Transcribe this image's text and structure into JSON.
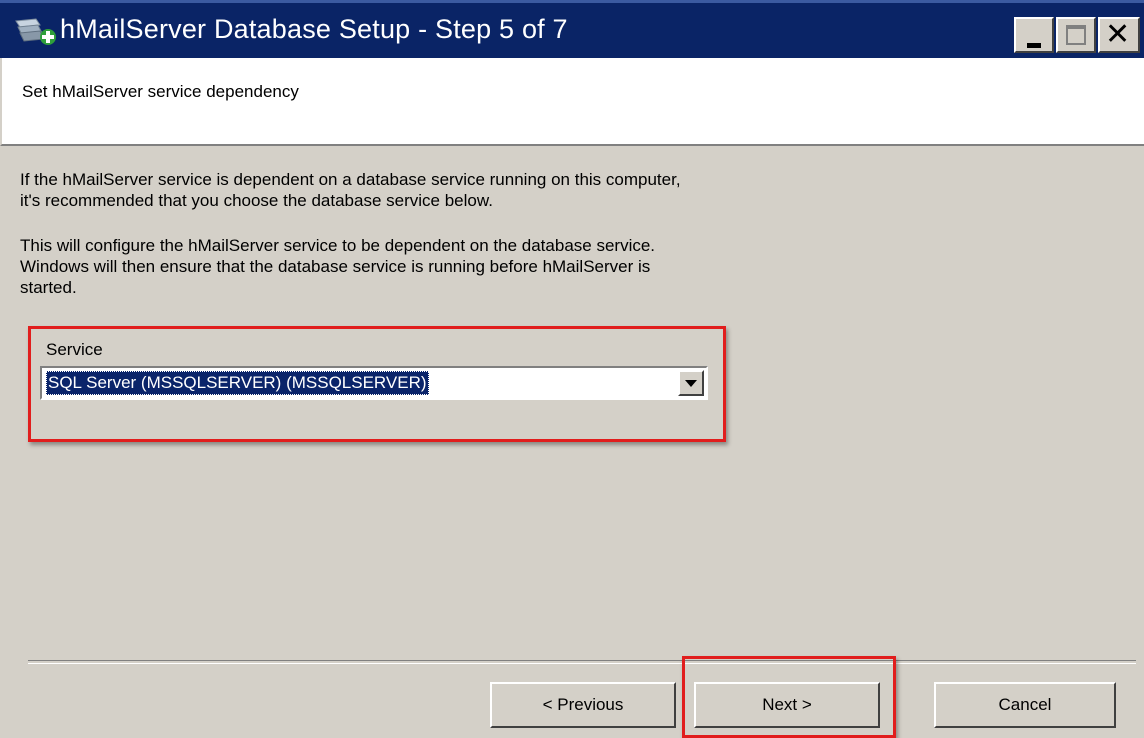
{
  "window": {
    "title": "hMailServer Database Setup - Step 5 of 7",
    "titlebar_color": "#0a2466",
    "icon": "hmailserver-app-icon"
  },
  "header": {
    "text": "Set hMailServer service dependency"
  },
  "description": {
    "paragraph1_line1": "If the hMailServer service is dependent on a database service running on this computer,",
    "paragraph1_line2": "it's recommended that you choose the database service below.",
    "paragraph2_line1": "This will configure the hMailServer service to be dependent on the database service.",
    "paragraph2_line2": "Windows will then ensure that the database service is running before hMailServer is",
    "paragraph2_line3": "started."
  },
  "service": {
    "label": "Service",
    "selected_value": "SQL Server (MSSQLSERVER) (MSSQLSERVER)"
  },
  "buttons": {
    "previous": "< Previous",
    "next": "Next >",
    "cancel": "Cancel"
  },
  "annotation_color": "#e11d1d"
}
